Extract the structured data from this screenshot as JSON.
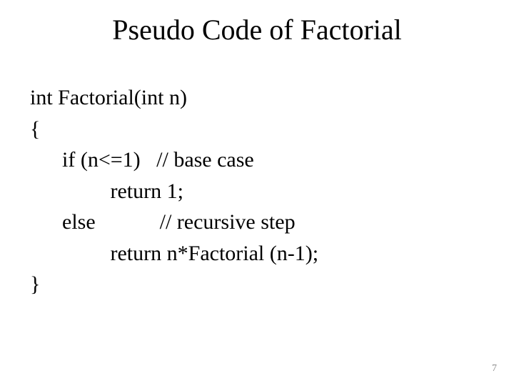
{
  "title": "Pseudo Code of Factorial",
  "code": {
    "l1": "int Factorial(int n)",
    "l2": "{",
    "l3": "      if (n<=1)   // base case",
    "l4": "               return 1;",
    "l5": "      else            // recursive step",
    "l6": "               return n*Factorial (n-1);",
    "l7": "}"
  },
  "page_number": "7"
}
